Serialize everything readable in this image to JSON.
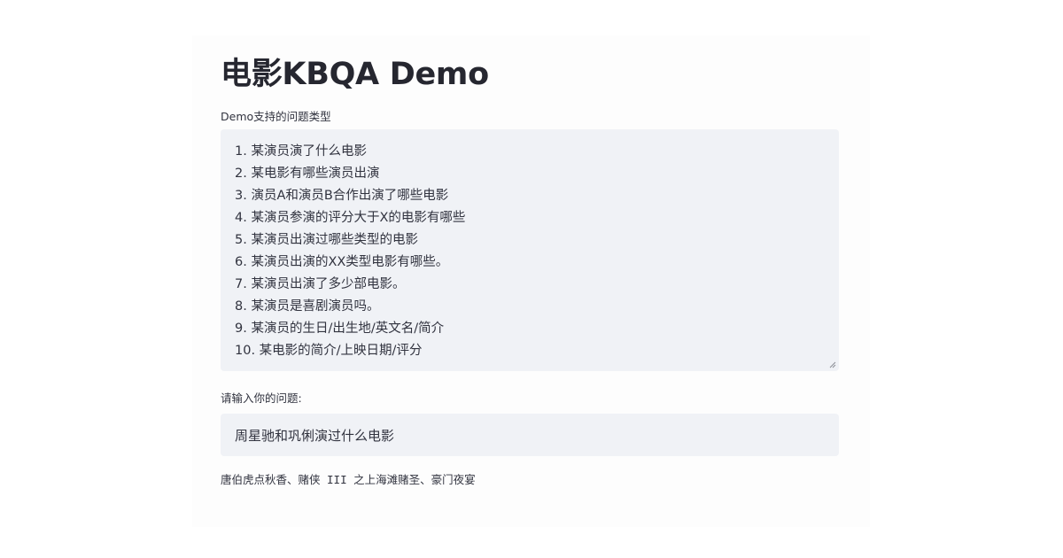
{
  "app": {
    "title": "电影KBQA Demo"
  },
  "question_types": {
    "label": "Demo支持的问题类型",
    "lines": [
      "1. 某演员演了什么电影",
      "2. 某电影有哪些演员出演",
      "3. 演员A和演员B合作出演了哪些电影",
      "4. 某演员参演的评分大于X的电影有哪些",
      "5. 某演员出演过哪些类型的电影",
      "6. 某演员出演的XX类型电影有哪些。",
      "7. 某演员出演了多少部电影。",
      "8. 某演员是喜剧演员吗。",
      "9. 某演员的生日/出生地/英文名/简介",
      "10. 某电影的简介/上映日期/评分"
    ]
  },
  "question_input": {
    "label": "请输入你的问题:",
    "value": "周星驰和巩俐演过什么电影"
  },
  "answer": {
    "text": "唐伯虎点秋香、赌侠 III 之上海滩赌圣、豪门夜宴"
  }
}
